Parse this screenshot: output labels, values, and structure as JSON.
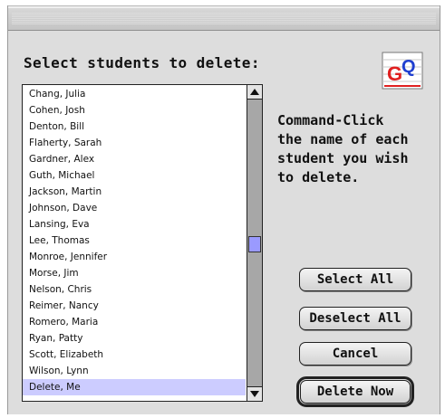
{
  "dialog": {
    "heading": "Select students to delete:",
    "instructions": [
      "Command-Click",
      "the name of each",
      "student you wish",
      "to delete."
    ]
  },
  "app_icon": {
    "name": "gradequick-icon",
    "letters": "GQ",
    "colors": {
      "g": "#e02020",
      "q": "#1f3fd0"
    }
  },
  "students": {
    "items": [
      "Chang, Julia",
      "Cohen, Josh",
      "Denton, Bill",
      "Flaherty, Sarah",
      "Gardner, Alex",
      "Guth, Michael",
      "Jackson, Martin",
      "Johnson, Dave",
      "Lansing, Eva",
      "Lee, Thomas",
      "Monroe, Jennifer",
      "Morse, Jim",
      "Nelson, Chris",
      "Reimer, Nancy",
      "Romero, Maria",
      "Ryan, Patty",
      "Scott, Elizabeth",
      "Wilson, Lynn",
      "Delete, Me"
    ],
    "selected_index": 18,
    "selection_color": "#ccccff"
  },
  "buttons": {
    "select_all": "Select All",
    "deselect_all": "Deselect All",
    "cancel": "Cancel",
    "delete_now": "Delete Now"
  }
}
